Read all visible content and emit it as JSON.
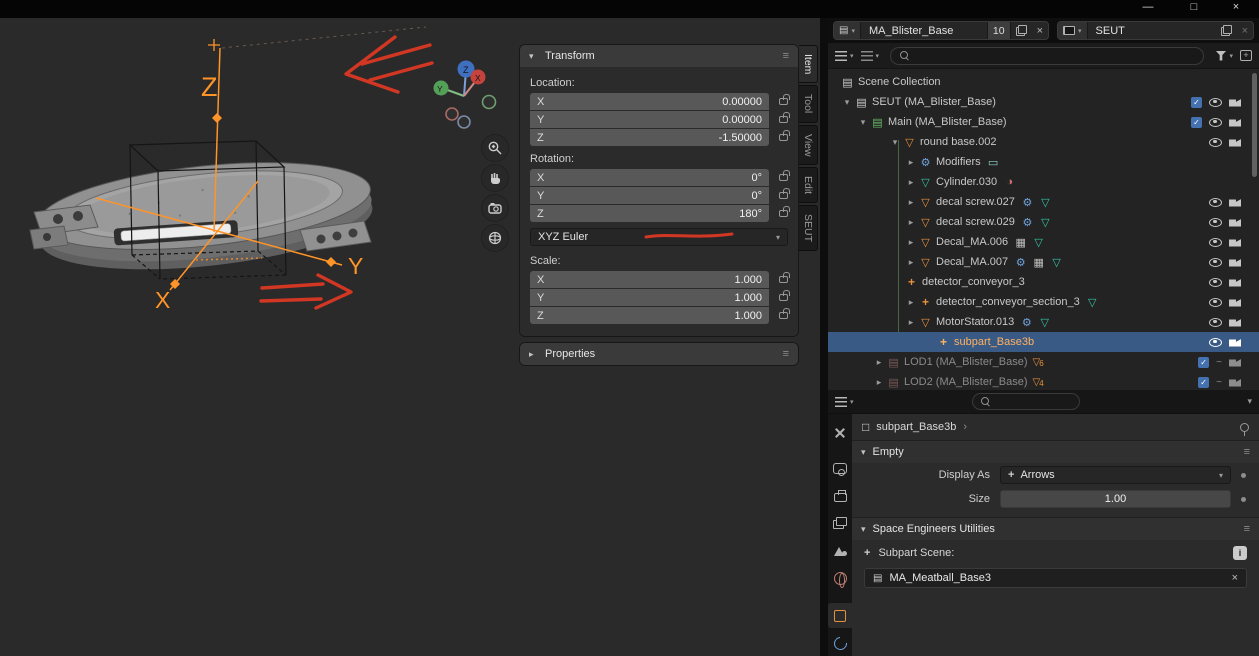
{
  "colors": {
    "accent_orange": "#e8923c",
    "selection_blue": "#4472b0",
    "annotation_red": "#d23723"
  },
  "window": {
    "minimize": "—",
    "maximize": "□",
    "close": "×"
  },
  "topbar": {
    "scene": {
      "name": "MA_Blister_Base",
      "users": "10"
    },
    "view_layer": {
      "name": "SEUT"
    }
  },
  "viewport": {
    "axis_z": "Z",
    "axis_y": "Y",
    "axis_x": "X",
    "gizmo": {
      "x": "X",
      "y": "Y",
      "z": "Z"
    }
  },
  "npanel": {
    "tabs": [
      "Item",
      "Tool",
      "View",
      "Edit",
      "SEUT"
    ],
    "transform": {
      "title": "Transform",
      "location_label": "Location:",
      "location": [
        {
          "axis": "X",
          "value": "0.00000"
        },
        {
          "axis": "Y",
          "value": "0.00000"
        },
        {
          "axis": "Z",
          "value": "-1.50000"
        }
      ],
      "rotation_label": "Rotation:",
      "rotation": [
        {
          "axis": "X",
          "value": "0°"
        },
        {
          "axis": "Y",
          "value": "0°"
        },
        {
          "axis": "Z",
          "value": "180°"
        }
      ],
      "rotation_mode": "XYZ Euler",
      "scale_label": "Scale:",
      "scale": [
        {
          "axis": "X",
          "value": "1.000"
        },
        {
          "axis": "Y",
          "value": "1.000"
        },
        {
          "axis": "Z",
          "value": "1.000"
        }
      ]
    },
    "properties_title": "Properties"
  },
  "outliner": {
    "rows": [
      {
        "label": "Scene Collection",
        "indent": 0,
        "expander": "none",
        "icon": "collection"
      },
      {
        "label": "SEUT (MA_Blister_Base)",
        "indent": 0,
        "expander": "open",
        "icon": "collection",
        "right": [
          "check",
          "eye",
          "cam"
        ]
      },
      {
        "label": "Main (MA_Blister_Base)",
        "indent": 1,
        "expander": "open",
        "icon": "collection-green",
        "right": [
          "check",
          "eye",
          "cam"
        ]
      },
      {
        "label": "round base.002",
        "indent": 3,
        "expander": "open",
        "icon": "mesh-obj",
        "right": [
          "eye",
          "cam"
        ]
      },
      {
        "label": "Modifiers",
        "indent": 4,
        "expander": "closed",
        "icon": "wrench",
        "extras": [
          "screen"
        ]
      },
      {
        "label": "Cylinder.030",
        "indent": 4,
        "expander": "closed",
        "icon": "mesh-data",
        "extras": [
          "material"
        ]
      },
      {
        "label": "decal screw.027",
        "indent": 4,
        "expander": "closed",
        "icon": "mesh-obj",
        "extras": [
          "wrench",
          "mesh-data"
        ],
        "right": [
          "eye",
          "cam"
        ]
      },
      {
        "label": "decal screw.029",
        "indent": 4,
        "expander": "closed",
        "icon": "mesh-obj",
        "extras": [
          "wrench",
          "mesh-data"
        ],
        "right": [
          "eye",
          "cam"
        ]
      },
      {
        "label": "Decal_MA.006",
        "indent": 4,
        "expander": "closed",
        "icon": "mesh-obj",
        "extras": [
          "grid",
          "mesh-data"
        ],
        "right": [
          "eye",
          "cam"
        ]
      },
      {
        "label": "Decal_MA.007",
        "indent": 4,
        "expander": "closed",
        "icon": "mesh-obj",
        "extras": [
          "wrench",
          "grid",
          "mesh-data"
        ],
        "right": [
          "eye",
          "cam"
        ]
      },
      {
        "label": "detector_conveyor_3",
        "indent": 4,
        "expander": "none",
        "icon": "empty",
        "right": [
          "eye",
          "cam"
        ]
      },
      {
        "label": "detector_conveyor_section_3",
        "indent": 4,
        "expander": "closed",
        "icon": "empty",
        "extras": [
          "mesh-data"
        ],
        "right": [
          "eye",
          "cam"
        ]
      },
      {
        "label": "MotorStator.013",
        "indent": 4,
        "expander": "closed",
        "icon": "mesh-obj",
        "extras": [
          "wrench",
          "mesh-data"
        ],
        "right": [
          "eye",
          "cam"
        ]
      },
      {
        "label": "subpart_Base3b",
        "indent": 6,
        "expander": "none",
        "icon": "empty-active",
        "selected": true,
        "right": [
          "eye",
          "cam"
        ]
      },
      {
        "label": "LOD1 (MA_Blister_Base)",
        "indent": 2,
        "expander": "closed",
        "icon": "collection-muted",
        "muted": true,
        "badge": "6",
        "right": [
          "check",
          "dash",
          "cam"
        ]
      },
      {
        "label": "LOD2 (MA_Blister_Base)",
        "indent": 2,
        "expander": "closed",
        "icon": "collection-muted",
        "muted": true,
        "badge": "4",
        "right": [
          "check",
          "dash",
          "cam"
        ]
      }
    ]
  },
  "properties": {
    "breadcrumb": "subpart_Base3b",
    "empty": {
      "title": "Empty",
      "display_as_label": "Display As",
      "display_as_value": "Arrows",
      "size_label": "Size",
      "size_value": "1.00"
    },
    "seut": {
      "title": "Space Engineers Utilities",
      "subpart_label": "Subpart Scene:",
      "scene_value": "MA_Meatball_Base3"
    }
  }
}
